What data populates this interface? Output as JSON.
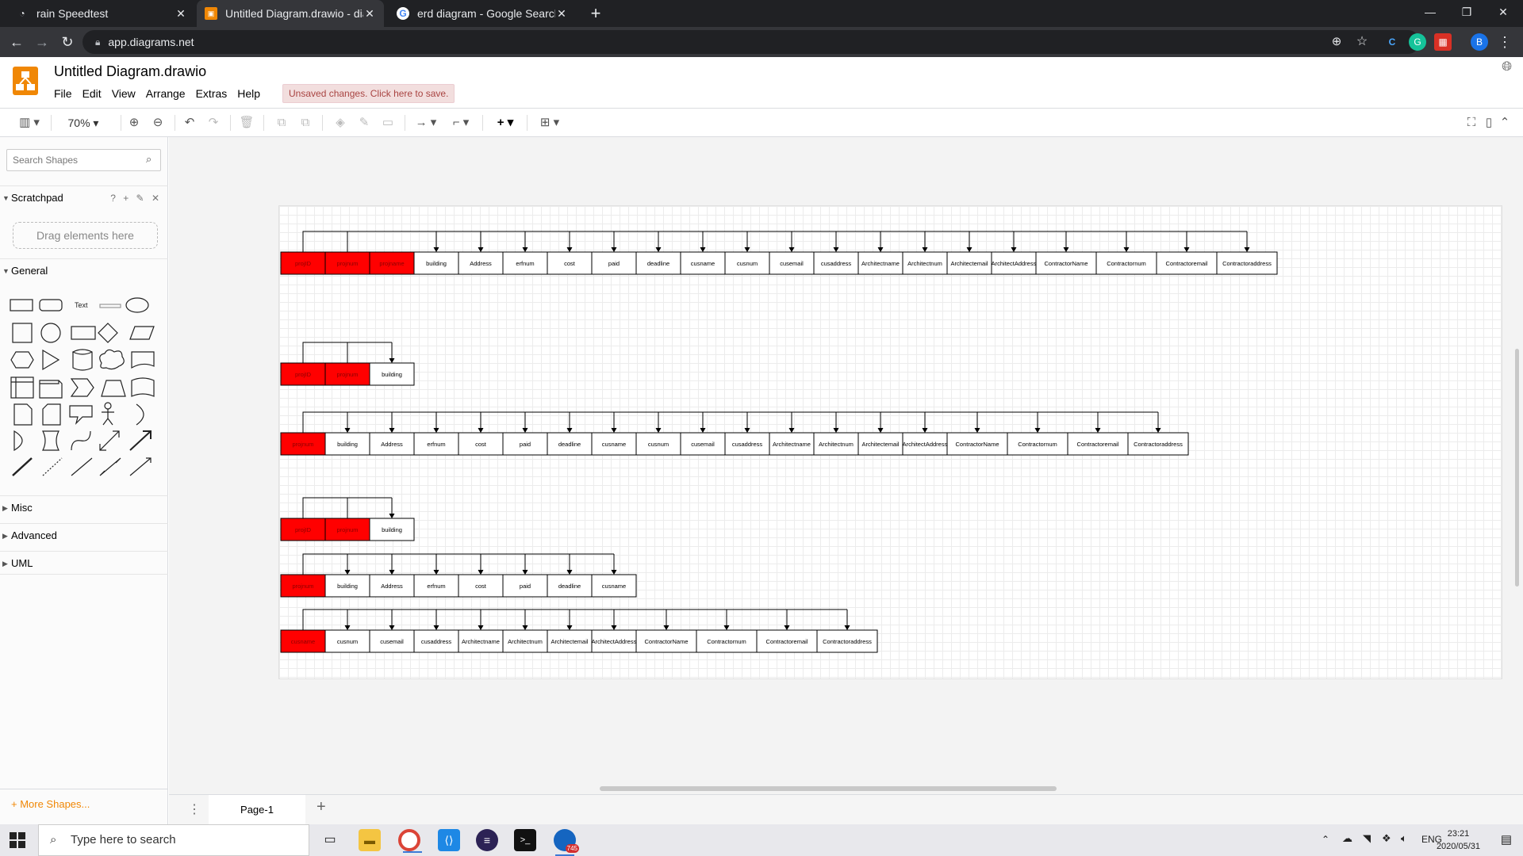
{
  "browser": {
    "tabs": [
      {
        "title": "rain Speedtest",
        "favicon": "speedtest-icon"
      },
      {
        "title": "Untitled Diagram.drawio - diagrams.net",
        "favicon": "drawio-icon"
      },
      {
        "title": "erd diagram - Google Search",
        "favicon": "google-icon"
      }
    ],
    "url": "app.diagrams.net",
    "profile_initial": "B"
  },
  "app": {
    "title": "Untitled Diagram.drawio",
    "menus": [
      "File",
      "Edit",
      "View",
      "Arrange",
      "Extras",
      "Help"
    ],
    "unsaved": "Unsaved changes. Click here to save.",
    "zoom": "70%",
    "brand_color": "#f08705"
  },
  "sidebar": {
    "search_placeholder": "Search Shapes",
    "scratchpad": "Scratchpad",
    "scratchpad_tools": "? + ✎ ✕",
    "drag_hint": "Drag elements here",
    "sections": {
      "general": "General",
      "misc": "Misc",
      "advanced": "Advanced",
      "uml": "UML"
    },
    "text_shape": "Text",
    "more_shapes": "+ More Shapes..."
  },
  "pages": {
    "current": "Page-1"
  },
  "diagram": {
    "tables": [
      {
        "cells": [
          "projID",
          "projnum",
          "projname",
          "building",
          "Address",
          "erfnum",
          "cost",
          "paid",
          "deadline",
          "cusname",
          "cusnum",
          "cusemail",
          "cusaddress",
          "Architectname",
          "Architectnum",
          "Architectemail",
          "ArchitectAddress",
          "ContractorName",
          "Contractornum",
          "Contractoremail",
          "Contractoraddress"
        ],
        "keys": 3
      },
      {
        "cells": [
          "projID",
          "projnum",
          "building"
        ],
        "keys": 2
      },
      {
        "cells": [
          "projnum",
          "building",
          "Address",
          "erfnum",
          "cost",
          "paid",
          "deadline",
          "cusname",
          "cusnum",
          "cusemail",
          "cusaddress",
          "Architectname",
          "Architectnum",
          "Architectemail",
          "ArchitectAddress",
          "ContractorName",
          "Contractornum",
          "Contractoremail",
          "Contractoraddress"
        ],
        "keys": 1
      },
      {
        "cells": [
          "projID",
          "projnum",
          "building"
        ],
        "keys": 2
      },
      {
        "cells": [
          "projnum",
          "building",
          "Address",
          "erfnum",
          "cost",
          "paid",
          "deadline",
          "cusname"
        ],
        "keys": 1
      },
      {
        "cells": [
          "cusname",
          "cusnum",
          "cusemail",
          "cusaddress",
          "Architectname",
          "Architectnum",
          "Architectemail",
          "ArchitectAddress",
          "ContractorName",
          "Contractornum",
          "Contractoremail",
          "Contractoraddress"
        ],
        "keys": 1
      }
    ],
    "key_color": "#ff0000"
  },
  "taskbar": {
    "search_placeholder": "Type here to search",
    "language": "ENG",
    "time": "23:21",
    "date": "2020/05/31",
    "badge": "745"
  }
}
